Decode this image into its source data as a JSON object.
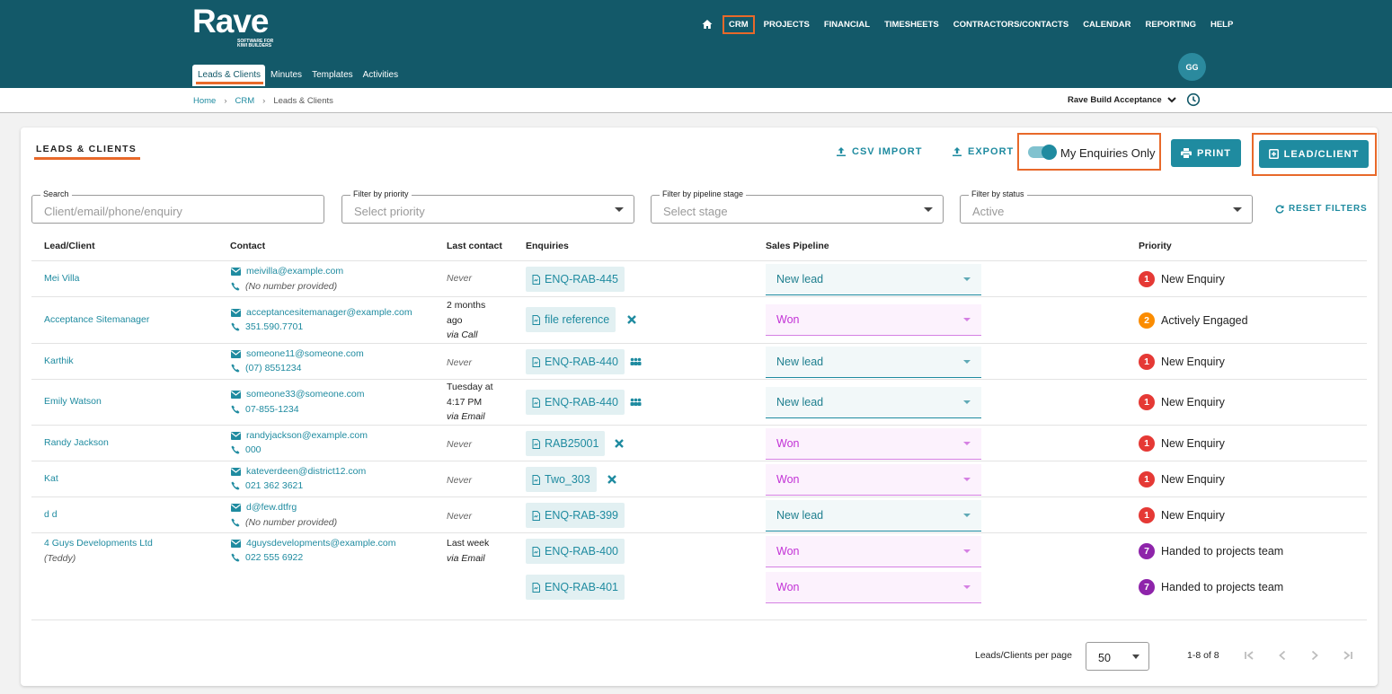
{
  "brand": {
    "name": "Rave",
    "tagline_1": "SOFTWARE FOR",
    "tagline_2": "KIWI BUILDERS"
  },
  "nav": {
    "items": [
      "CRM",
      "PROJECTS",
      "FINANCIAL",
      "TIMESHEETS",
      "CONTRACTORS/CONTACTS",
      "CALENDAR",
      "REPORTING",
      "HELP"
    ]
  },
  "subnav": {
    "items": [
      "Leads & Clients",
      "Minutes",
      "Templates",
      "Activities"
    ]
  },
  "user": {
    "initials": "GG"
  },
  "breadcrumb": {
    "home": "Home",
    "crm": "CRM",
    "current": "Leads & Clients",
    "sep": "›"
  },
  "project_selector": {
    "value": "Rave Build Acceptance"
  },
  "card": {
    "title": "LEADS & CLIENTS",
    "csv_import": "CSV IMPORT",
    "export": "EXPORT",
    "my_enquiries": "My Enquiries Only",
    "print": "PRINT",
    "lead_client": "LEAD/CLIENT",
    "reset_filters": "RESET FILTERS"
  },
  "filters": {
    "search": {
      "label": "Search",
      "placeholder": "Client/email/phone/enquiry"
    },
    "priority": {
      "label": "Filter by priority",
      "value": "Select priority"
    },
    "stage": {
      "label": "Filter by pipeline stage",
      "value": "Select stage"
    },
    "status": {
      "label": "Filter by status",
      "value": "Active"
    }
  },
  "table": {
    "headers": [
      "Lead/Client",
      "Contact",
      "Last contact",
      "Enquiries",
      "Sales Pipeline",
      "Priority"
    ],
    "rows": [
      {
        "name": "Mei Villa",
        "email": "meivilla@example.com",
        "phone": "(No number provided)",
        "last1": "Never",
        "enq": "ENQ-RAB-445",
        "stage": "New lead",
        "prio_num": "1",
        "prio": "New Enquiry"
      },
      {
        "name": "Acceptance Sitemanager",
        "email": "acceptancesitemanager@example.com",
        "phone": "351.590.7701",
        "last1": "2 months",
        "last2": "ago",
        "last3": "via Call",
        "enq": "file reference",
        "stage": "Won",
        "prio_num": "2",
        "prio": "Actively Engaged"
      },
      {
        "name": "Karthik",
        "email": "someone11@someone.com",
        "phone": "(07) 8551234",
        "last1": "Never",
        "enq": "ENQ-RAB-440",
        "stage": "New lead",
        "prio_num": "1",
        "prio": "New Enquiry"
      },
      {
        "name": "Emily Watson",
        "email": "someone33@someone.com",
        "phone": "07-855-1234",
        "last1": "Tuesday at",
        "last2": "4:17 PM",
        "last3": "via Email",
        "enq": "ENQ-RAB-440",
        "stage": "New lead",
        "prio_num": "1",
        "prio": "New Enquiry"
      },
      {
        "name": "Randy Jackson",
        "email": "randyjackson@example.com",
        "phone": "000",
        "last1": "Never",
        "enq": "RAB25001",
        "stage": "Won",
        "prio_num": "1",
        "prio": "New Enquiry"
      },
      {
        "name": "Kat",
        "email": "kateverdeen@district12.com",
        "phone": "021 362 3621",
        "last1": "Never",
        "enq": "Two_303",
        "stage": "Won",
        "prio_num": "1",
        "prio": "New Enquiry"
      },
      {
        "name": "d d",
        "email": "d@few.dtfrg",
        "phone": "(No number provided)",
        "last1": "Never",
        "enq": "ENQ-RAB-399",
        "stage": "New lead",
        "prio_num": "1",
        "prio": "New Enquiry"
      },
      {
        "name": "4 Guys Developments Ltd",
        "sub": "(Teddy)",
        "email": "4guysdevelopments@example.com",
        "phone": "022 555 6922",
        "last1": "Last week",
        "last2": "via Email",
        "enq": "ENQ-RAB-400",
        "enq2": "ENQ-RAB-401",
        "stage": "Won",
        "stage2": "Won",
        "prio_num": "7",
        "prio": "Handed to projects team",
        "prio_num2": "7",
        "prio2": "Handed to projects team"
      }
    ]
  },
  "pagination": {
    "per_page_label": "Leads/Clients per page",
    "per_page": "50",
    "range": "1-8 of 8"
  },
  "colors": {
    "header_bg": "#135969",
    "accent": "#1f8ba0",
    "highlight": "#e8692a",
    "won": "#c231d6",
    "prio1": "#e53935",
    "prio2": "#fb8c00",
    "prio7": "#8e24aa"
  }
}
